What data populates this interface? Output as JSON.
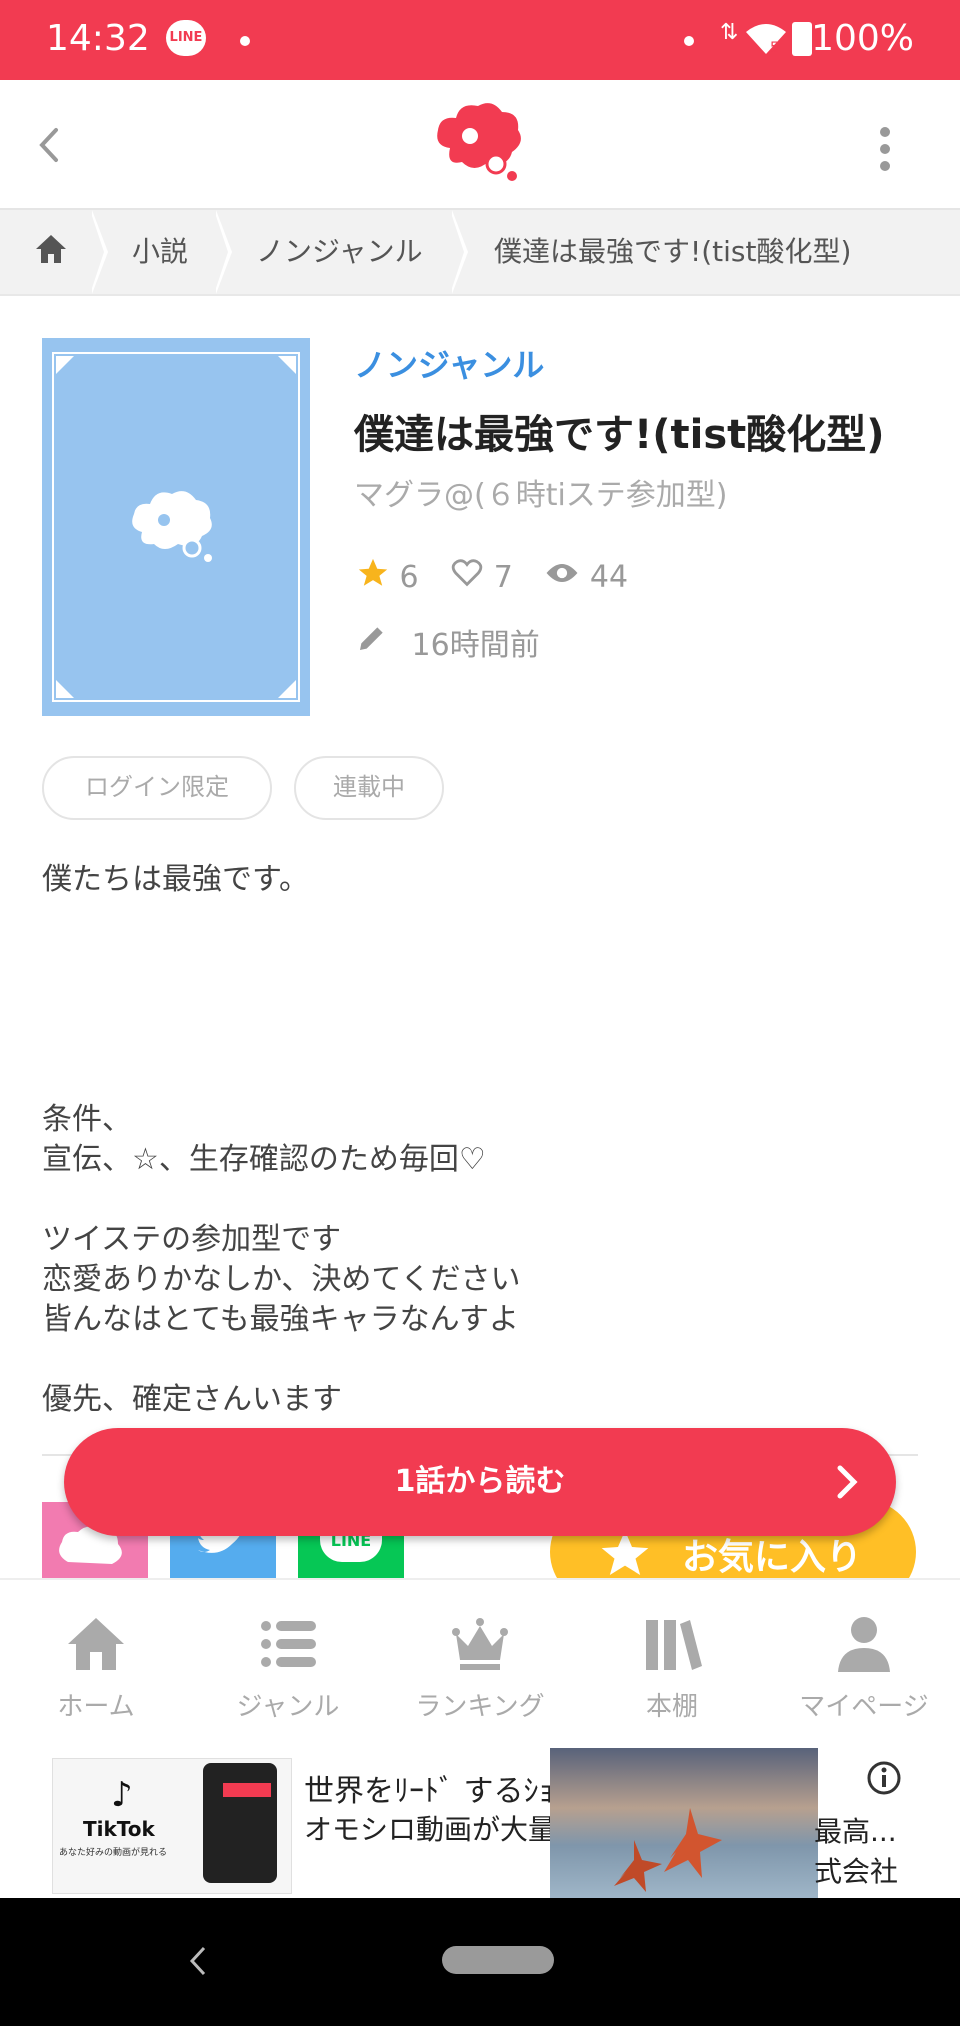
{
  "status_bar": {
    "time": "14:32",
    "notification_app": "LINE",
    "battery": "100%",
    "network": "5"
  },
  "app_bar": {
    "logo_icon": "app-logo-icon",
    "back_icon": "chevron-left-icon",
    "menu_icon": "more-vertical-icon"
  },
  "breadcrumb": {
    "home_icon": "home-icon",
    "items": [
      "小説",
      "ノンジャンル",
      "僕達は最強です!(tist酸化型)"
    ]
  },
  "novel": {
    "genre": "ノンジャンル",
    "title": "僕達は最強です!(tist酸化型)",
    "author": "マグラ@(６時tiステ参加型)",
    "stars": "6",
    "likes": "7",
    "views": "44",
    "updated": "16時間前",
    "tags": [
      "ログイン限定",
      "連載中"
    ],
    "description": "僕たちは最強です。\n\n\n\n\n\n条件、\n宣伝、☆、生存確認のため毎回♡\n\nツイステの参加型です\n恋愛ありかなしか、決めてください\n皆んなはとても最強キャラなんすよ\n\n優先、確定さんいます"
  },
  "actions": {
    "read_button": "1話から読む",
    "favorite_button": "お気に入り",
    "share": [
      "LINE"
    ]
  },
  "bottom_nav": {
    "items": [
      "ホーム",
      "ジャンル",
      "ランキング",
      "本棚",
      "マイページ"
    ]
  },
  "ad": {
    "line1": "世界をﾘｰﾄﾞ するｼｮ",
    "line2": "オモシロ動画が大量",
    "right1": "最高...",
    "right2": "式会社",
    "thumb_brand": "TikTok",
    "thumb_caption": "あなた好みの動画が見れる"
  },
  "colors": {
    "brand": "#f23b51",
    "genre": "#3b8fe0",
    "favorite": "#ffbf26",
    "cover": "#97c4ef",
    "star": "#f8b41c"
  }
}
